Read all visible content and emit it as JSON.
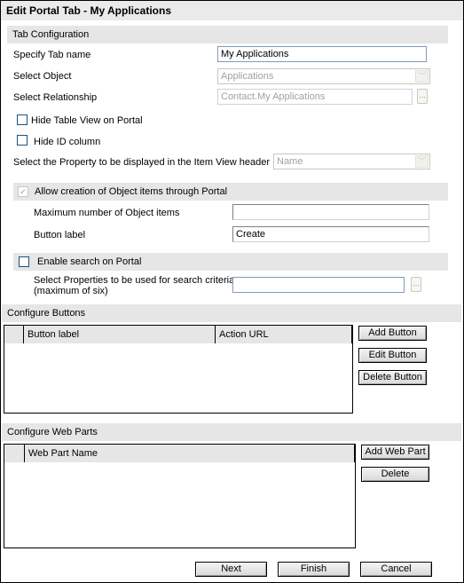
{
  "window": {
    "title": "Edit Portal Tab - My  Applications"
  },
  "tab_configuration": {
    "section_label": "Tab Configuration",
    "tab_name_label": "Specify Tab name",
    "tab_name_value": "My Applications",
    "object_label": "Select Object",
    "object_value": "Applications",
    "relationship_label": "Select Relationship",
    "relationship_value": "Contact.My Applications",
    "hide_table_view_label": "Hide Table View on Portal",
    "hide_table_view_checked": false,
    "hide_id_label": "Hide ID column",
    "hide_id_checked": false,
    "item_view_header_label": "Select the Property to be displayed in the Item View header",
    "item_view_header_value": "Name",
    "ellipsis": "..."
  },
  "creation": {
    "allow_label": "Allow creation of Object items through Portal",
    "allow_checked": true,
    "check_glyph": "✔",
    "max_items_label": "Maximum number of Object items",
    "max_items_value": "",
    "button_label_label": "Button label",
    "button_label_value": "Create"
  },
  "search": {
    "enable_label": "Enable search on Portal",
    "enable_checked": false,
    "properties_label_line1": "Select Properties to be used for search criteria",
    "properties_label_line2": "(maximum of six)",
    "properties_value": "",
    "ellipsis": "..."
  },
  "configure_buttons": {
    "section_label": "Configure Buttons",
    "columns": [
      "Button label",
      "Action URL"
    ],
    "rows": [],
    "add_button": "Add Button",
    "edit_button": "Edit Button",
    "delete_button": "Delete Button"
  },
  "configure_web_parts": {
    "section_label": "Configure Web Parts",
    "columns": [
      "Web Part Name"
    ],
    "rows": [],
    "add_button": "Add Web Part",
    "delete_button": "Delete"
  },
  "footer": {
    "next": "Next",
    "finish": "Finish",
    "cancel": "Cancel"
  },
  "icons": {
    "dropdown_arrow": "﹀"
  }
}
